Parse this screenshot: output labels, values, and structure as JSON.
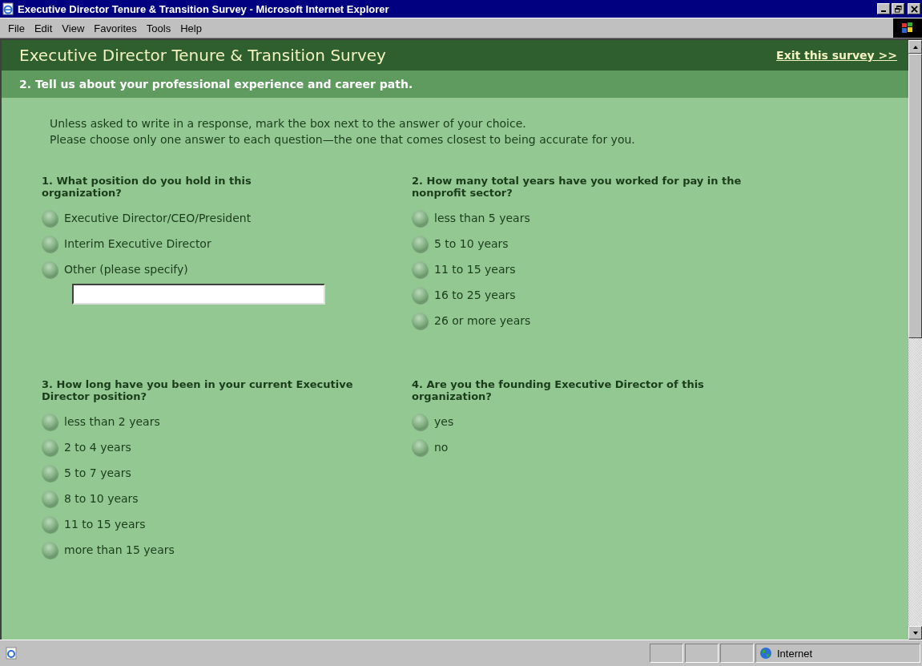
{
  "window": {
    "title": "Executive Director Tenure & Transition Survey - Microsoft Internet Explorer"
  },
  "menu": [
    "File",
    "Edit",
    "View",
    "Favorites",
    "Tools",
    "Help"
  ],
  "survey": {
    "title": "Executive Director Tenure & Transition Survey",
    "exit_link": "Exit this survey >>",
    "section": "2. Tell us about your professional experience and career path.",
    "instructions": [
      "Unless asked to write in a response, mark the box next to the answer of your choice.",
      "Please choose only one answer to each question—the one that comes closest to being accurate for you."
    ],
    "questions": [
      {
        "text": "1. What position do you hold in this organization?",
        "options": [
          {
            "label": "Executive Director/CEO/President",
            "selected": false
          },
          {
            "label": "Interim Executive Director",
            "selected": false
          },
          {
            "label": "Other (please specify)",
            "selected": false,
            "has_field": true
          }
        ]
      },
      {
        "text": "2. How many total years have you worked for pay in the nonprofit sector?",
        "options": [
          {
            "label": "less than 5 years",
            "selected": false
          },
          {
            "label": "5 to 10 years",
            "selected": false
          },
          {
            "label": "11 to 15 years",
            "selected": false
          },
          {
            "label": "16 to 25 years",
            "selected": false
          },
          {
            "label": "26 or more years",
            "selected": false
          }
        ]
      },
      {
        "text": "3. How long have you been in your current Executive Director position?",
        "options": [
          {
            "label": "less than 2 years",
            "selected": false
          },
          {
            "label": "2 to 4 years",
            "selected": false
          },
          {
            "label": "5 to 7 years",
            "selected": false
          },
          {
            "label": "8 to 10 years",
            "selected": false
          },
          {
            "label": "11 to 15 years",
            "selected": false
          },
          {
            "label": "more than 15 years",
            "selected": false
          }
        ]
      },
      {
        "text": "4. Are you the founding Executive Director of this organization?",
        "options": [
          {
            "label": "yes",
            "selected": false
          },
          {
            "label": "no",
            "selected": false
          }
        ]
      }
    ]
  },
  "status_bar": {
    "zone": "Internet"
  }
}
